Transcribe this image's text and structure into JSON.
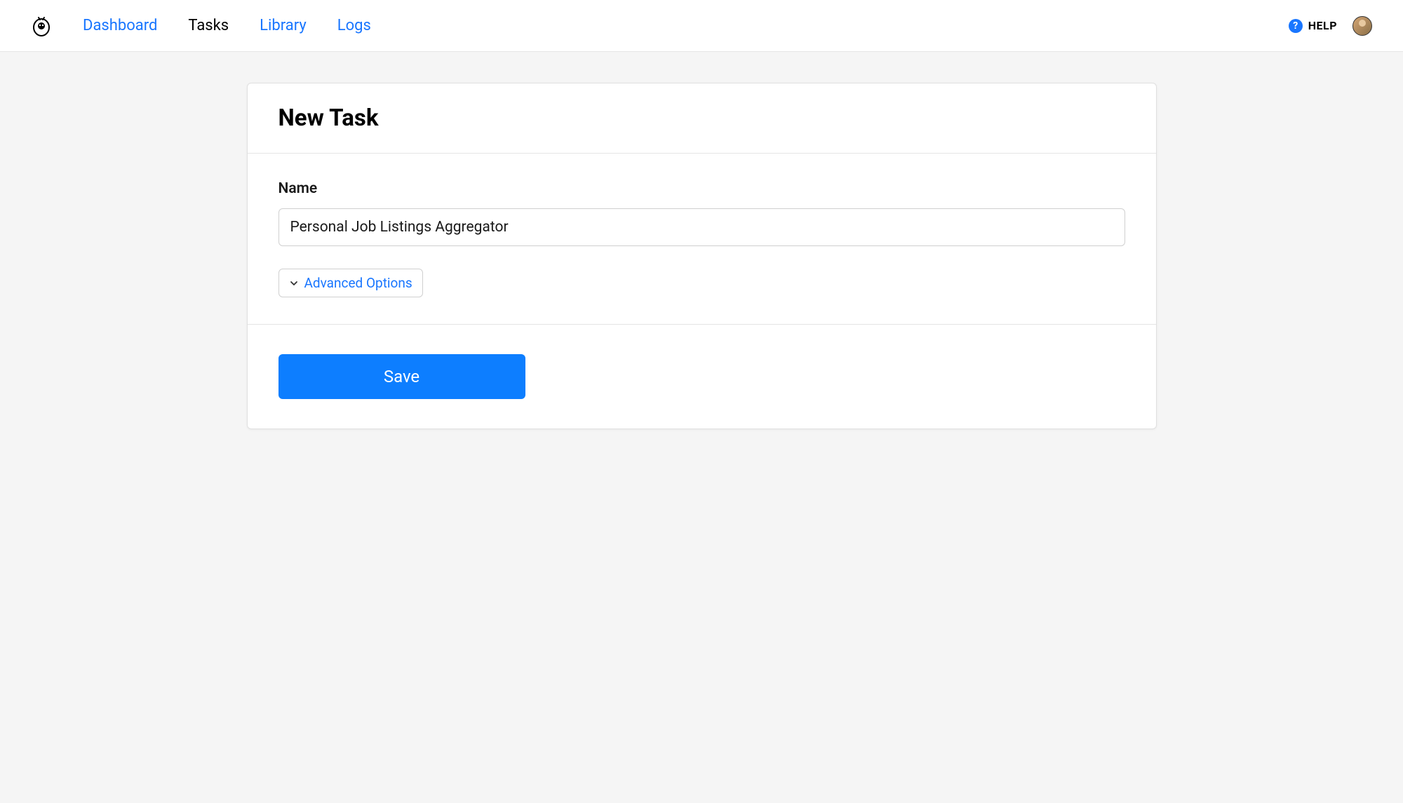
{
  "nav": {
    "items": [
      {
        "label": "Dashboard",
        "active": false
      },
      {
        "label": "Tasks",
        "active": true
      },
      {
        "label": "Library",
        "active": false
      },
      {
        "label": "Logs",
        "active": false
      }
    ]
  },
  "header": {
    "help_label": "HELP"
  },
  "card": {
    "title": "New Task",
    "name_label": "Name",
    "name_value": "Personal Job Listings Aggregator",
    "advanced_options_label": "Advanced Options",
    "save_label": "Save"
  }
}
